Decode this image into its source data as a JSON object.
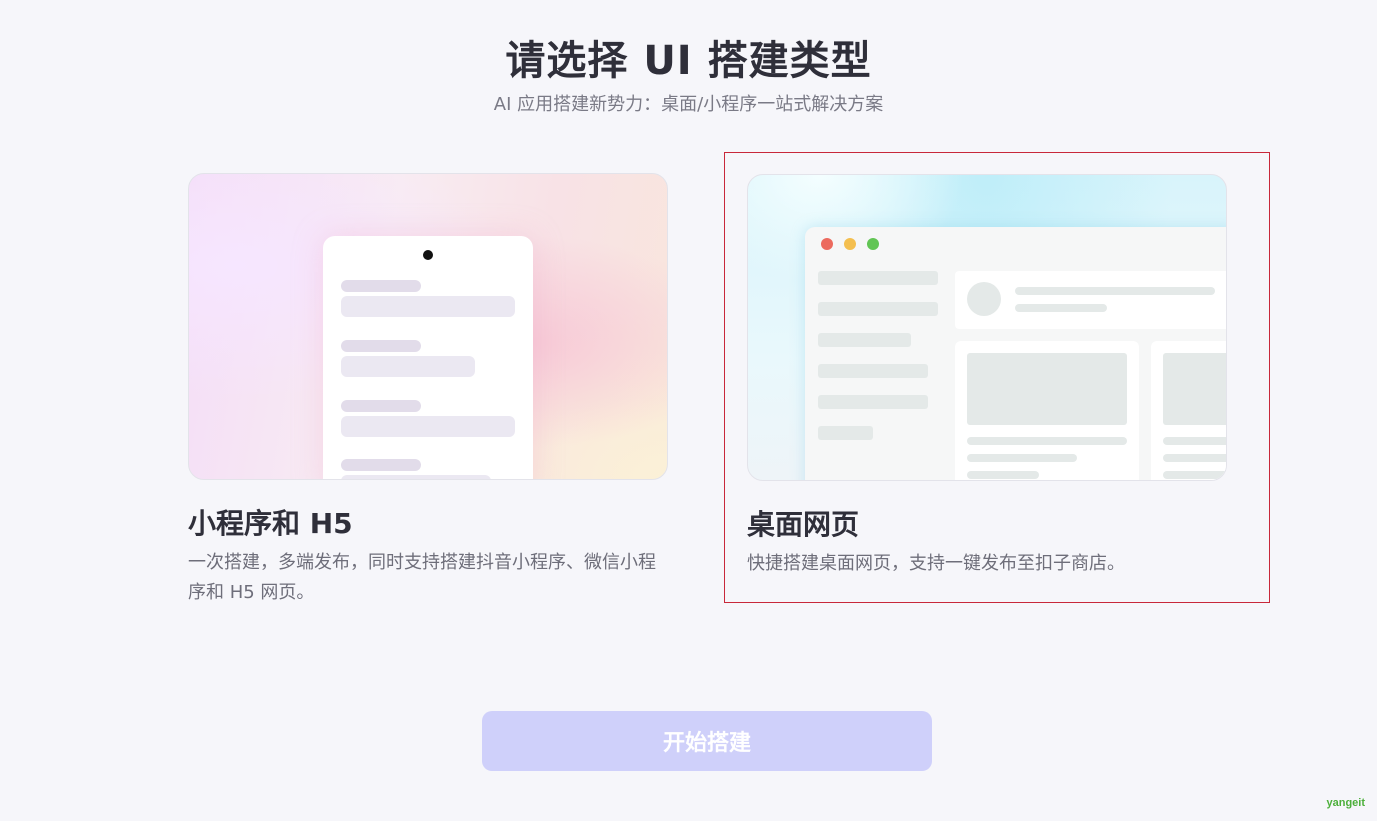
{
  "header": {
    "title": "请选择 UI 搭建类型",
    "subtitle": "AI 应用搭建新势力：桌面/小程序一站式解决方案"
  },
  "cards": [
    {
      "title": "小程序和 H5",
      "description": "一次搭建，多端发布，同时支持搭建抖音小程序、微信小程序和 H5 网页。",
      "selected": false
    },
    {
      "title": "桌面网页",
      "description": "快捷搭建桌面网页，支持一键发布至扣子商店。",
      "selected": true
    }
  ],
  "actions": {
    "start_label": "开始搭建"
  },
  "watermark": "yangeit",
  "colors": {
    "selected_border": "#c8283a",
    "start_button_bg": "#cfd0fa",
    "traffic_red": "#ec6a5e",
    "traffic_yellow": "#f4bf4f",
    "traffic_green": "#61c554"
  }
}
